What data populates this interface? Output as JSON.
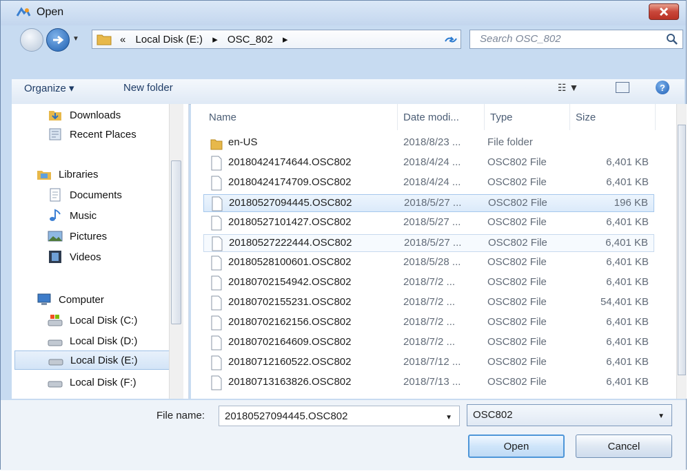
{
  "window": {
    "title": "Open"
  },
  "address": {
    "crumbs": [
      "«",
      "Local Disk (E:)",
      "▸",
      "OSC_802",
      "▸"
    ],
    "search_placeholder": "Search OSC_802"
  },
  "toolbar": {
    "organize": "Organize ▾",
    "new_folder": "New folder"
  },
  "sidebar": {
    "items": [
      {
        "label": "Downloads",
        "icon": "downloads-icon"
      },
      {
        "label": "Recent Places",
        "icon": "recent-places-icon"
      },
      {
        "label": "Libraries",
        "icon": "libraries-icon"
      },
      {
        "label": "Documents",
        "icon": "documents-icon"
      },
      {
        "label": "Music",
        "icon": "music-icon"
      },
      {
        "label": "Pictures",
        "icon": "pictures-icon"
      },
      {
        "label": "Videos",
        "icon": "videos-icon"
      },
      {
        "label": "Computer",
        "icon": "computer-icon"
      },
      {
        "label": "Local Disk (C:)",
        "icon": "drive-c-icon"
      },
      {
        "label": "Local Disk (D:)",
        "icon": "drive-icon"
      },
      {
        "label": "Local Disk (E:)",
        "icon": "drive-icon",
        "selected": true
      },
      {
        "label": "Local Disk (F:)",
        "icon": "drive-icon"
      }
    ]
  },
  "columns": [
    "Name",
    "Date modi...",
    "Type",
    "Size"
  ],
  "files": [
    {
      "name": "en-US",
      "date": "2018/8/23 ...",
      "type": "File folder",
      "size": "",
      "folder": true
    },
    {
      "name": "20180424174644.OSC802",
      "date": "2018/4/24 ...",
      "type": "OSC802 File",
      "size": "6,401 KB"
    },
    {
      "name": "20180424174709.OSC802",
      "date": "2018/4/24 ...",
      "type": "OSC802 File",
      "size": "6,401 KB"
    },
    {
      "name": "20180527094445.OSC802",
      "date": "2018/5/27 ...",
      "type": "OSC802 File",
      "size": "196 KB",
      "selected": true
    },
    {
      "name": "20180527101427.OSC802",
      "date": "2018/5/27 ...",
      "type": "OSC802 File",
      "size": "6,401 KB"
    },
    {
      "name": "20180527222444.OSC802",
      "date": "2018/5/27 ...",
      "type": "OSC802 File",
      "size": "6,401 KB",
      "hover": true
    },
    {
      "name": "20180528100601.OSC802",
      "date": "2018/5/28 ...",
      "type": "OSC802 File",
      "size": "6,401 KB"
    },
    {
      "name": "20180702154942.OSC802",
      "date": "2018/7/2 ...",
      "type": "OSC802 File",
      "size": "6,401 KB"
    },
    {
      "name": "20180702155231.OSC802",
      "date": "2018/7/2 ...",
      "type": "OSC802 File",
      "size": "54,401 KB"
    },
    {
      "name": "20180702162156.OSC802",
      "date": "2018/7/2 ...",
      "type": "OSC802 File",
      "size": "6,401 KB"
    },
    {
      "name": "20180702164609.OSC802",
      "date": "2018/7/2 ...",
      "type": "OSC802 File",
      "size": "6,401 KB"
    },
    {
      "name": "20180712160522.OSC802",
      "date": "2018/7/12 ...",
      "type": "OSC802 File",
      "size": "6,401 KB"
    },
    {
      "name": "20180713163826.OSC802",
      "date": "2018/7/13 ...",
      "type": "OSC802 File",
      "size": "6,401 KB"
    }
  ],
  "bottom": {
    "file_name_label": "File name:",
    "file_name_value": "20180527094445.OSC802",
    "file_type": "OSC802",
    "open_label": "Open",
    "cancel_label": "Cancel"
  },
  "colors": {
    "frame": "#c7dbf1",
    "selection": "#dbeafa",
    "close": "#c9473a"
  }
}
